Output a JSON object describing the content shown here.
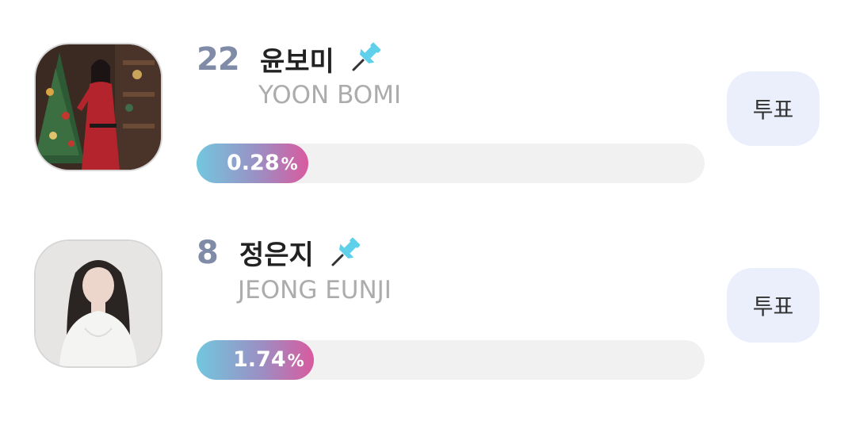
{
  "colors": {
    "rank": "#7f8ba7",
    "bar_gradient_start": "#72c7df",
    "bar_gradient_end": "#d95a9f",
    "vote_button_bg": "#ebeffb",
    "pin_icon": "#5fd0ea"
  },
  "candidates": [
    {
      "rank": "22",
      "name_ko": "윤보미",
      "name_en": "YOON BOMI",
      "percent_value": "0.28",
      "percent_sign": "%",
      "vote_label": "투표",
      "pin_icon": "pushpin-icon",
      "avatar": "christmas-tree-portrait"
    },
    {
      "rank": "8",
      "name_ko": "정은지",
      "name_en": "JEONG EUNJI",
      "percent_value": "1.74",
      "percent_sign": "%",
      "vote_label": "투표",
      "pin_icon": "pushpin-icon",
      "avatar": "white-top-portrait"
    }
  ]
}
